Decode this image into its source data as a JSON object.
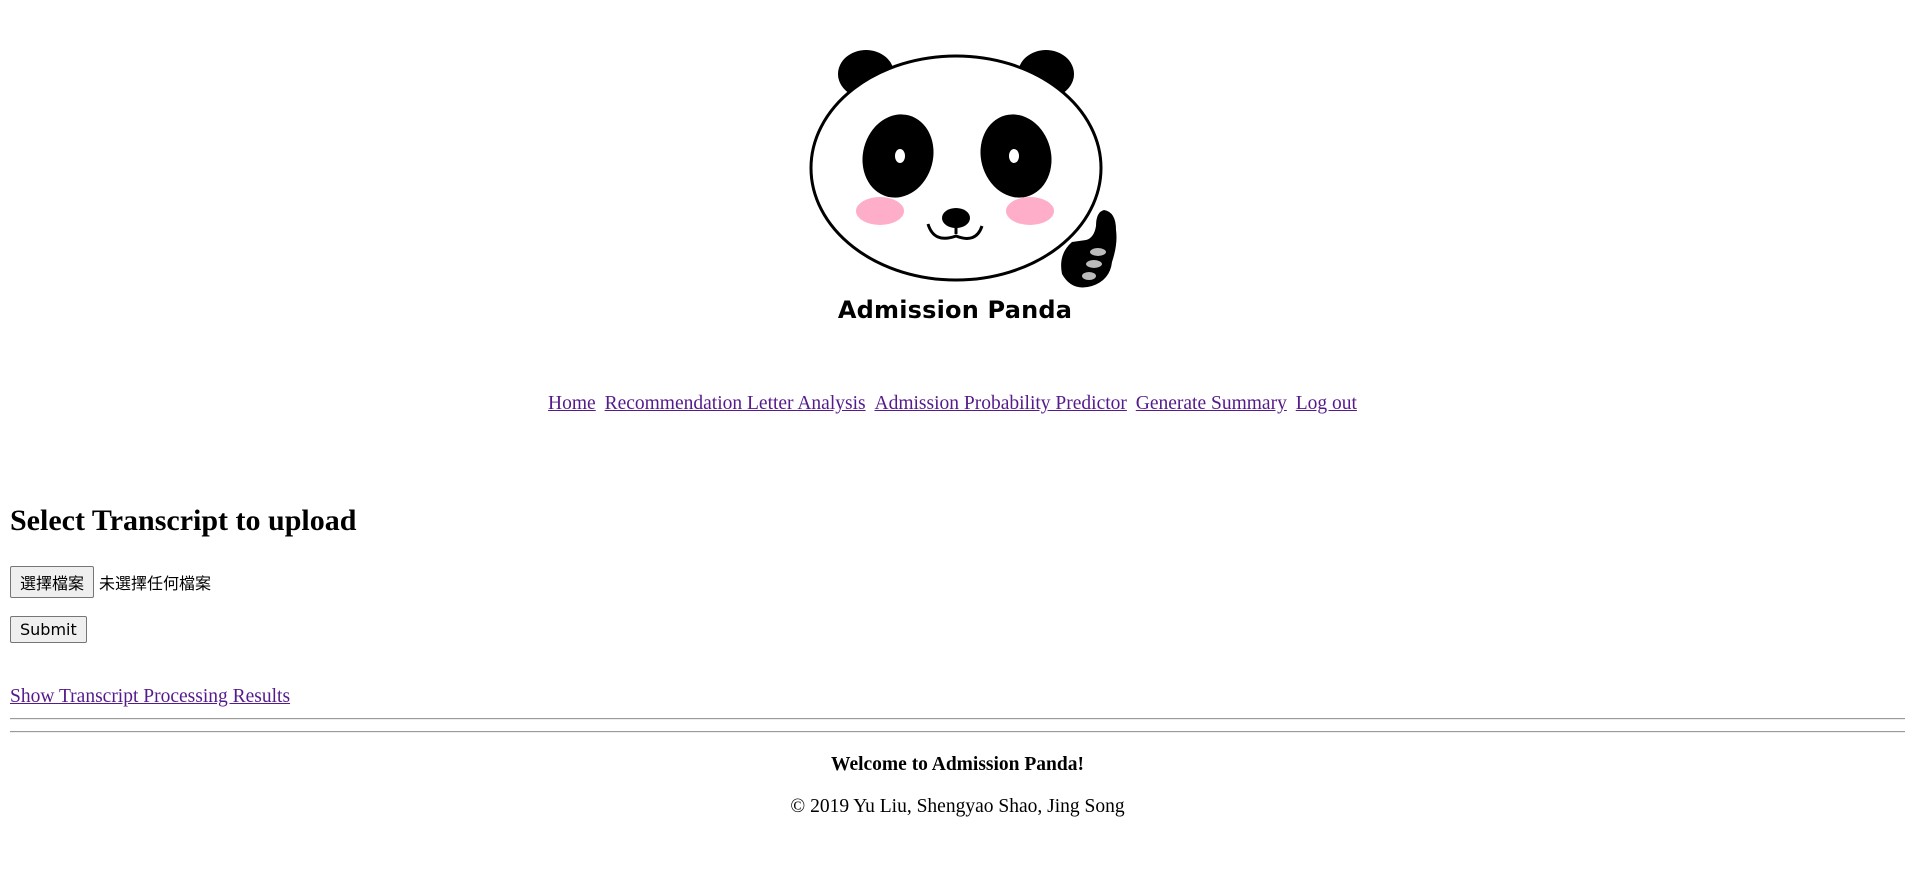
{
  "logo": {
    "text": "Admission Panda",
    "icon": "panda-thumbs-up-logo",
    "colors": {
      "cheek": "#ffaec9",
      "ink": "#000000"
    }
  },
  "nav": {
    "items": [
      {
        "label": "Home"
      },
      {
        "label": "Recommendation Letter Analysis"
      },
      {
        "label": "Admission Probability Predictor"
      },
      {
        "label": "Generate Summary"
      },
      {
        "label": "Log out"
      }
    ],
    "link_color": "#551a8b"
  },
  "upload": {
    "title": "Select Transcript to upload",
    "file_button_label": "選擇檔案",
    "file_status": "未選擇任何檔案",
    "submit_label": "Submit"
  },
  "results_link": "Show Transcript Processing Results",
  "footer": {
    "welcome": "Welcome to Admission Panda!",
    "copyright": "© 2019 Yu Liu, Shengyao Shao, Jing Song"
  }
}
